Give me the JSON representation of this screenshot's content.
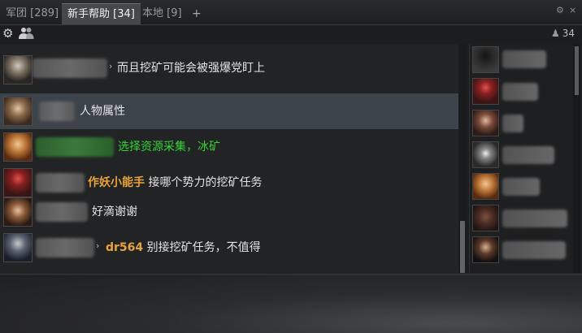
{
  "tabs": [
    {
      "label": "军团 [289]"
    },
    {
      "label": "新手帮助 [34]"
    },
    {
      "label": "本地 [9]"
    }
  ],
  "tab_add_label": "+",
  "window_buttons": {
    "settings": "⚙",
    "close": "×"
  },
  "toolbar": {
    "member_count": "34"
  },
  "messages": [
    {
      "text": "而且挖矿可能会被强爆党盯上",
      "color": "#e4e4e4"
    },
    {
      "text": "人物属性",
      "color": "#e4e4e4"
    },
    {
      "text": "选择资源采集，冰矿",
      "color": "#35d435"
    },
    {
      "sender": "作妖小能手",
      "text": "接哪个势力的挖矿任务",
      "color": "#e4e4e4"
    },
    {
      "text": "好滴谢谢",
      "color": "#e4e4e4"
    },
    {
      "sender": "dr564",
      "text": "别接挖矿任务，不值得",
      "color": "#e4e4e4"
    }
  ],
  "colors": {
    "accent_sender": "#e8a33a",
    "highlight_row": "#3d434b",
    "green_text": "#35d435"
  },
  "icons": [
    "settings-gear-icon",
    "people-icon",
    "person-icon"
  ]
}
